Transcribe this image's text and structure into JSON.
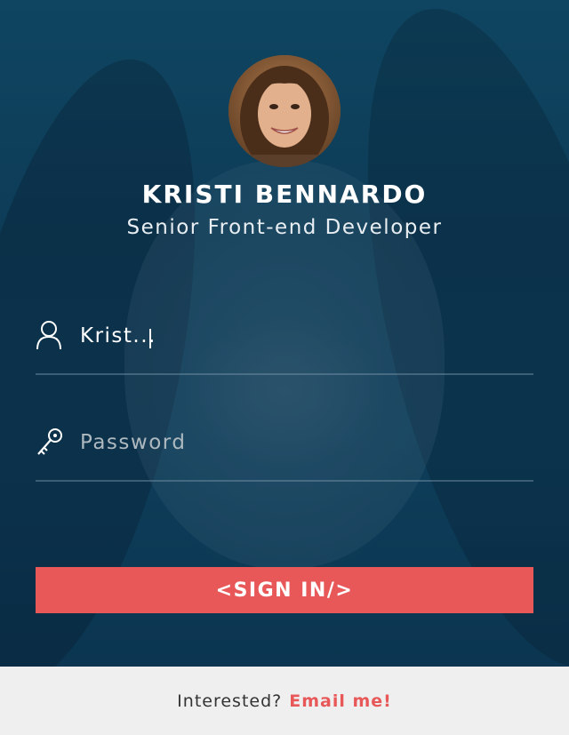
{
  "profile": {
    "name": "KRISTI BENNARDO",
    "role": "Senior Front-end Developer",
    "avatar_icon": "profile-photo"
  },
  "form": {
    "username": {
      "value": "Krist...",
      "icon": "user-icon"
    },
    "password": {
      "placeholder": "Password",
      "icon": "key-icon"
    },
    "signin_label": "<SIGN IN/>"
  },
  "footer": {
    "question": "Interested?",
    "email_link": "Email me!"
  },
  "colors": {
    "background": "#0f3a55",
    "accent": "#e85858",
    "footer_bg": "#efefef",
    "text": "#ffffff"
  }
}
